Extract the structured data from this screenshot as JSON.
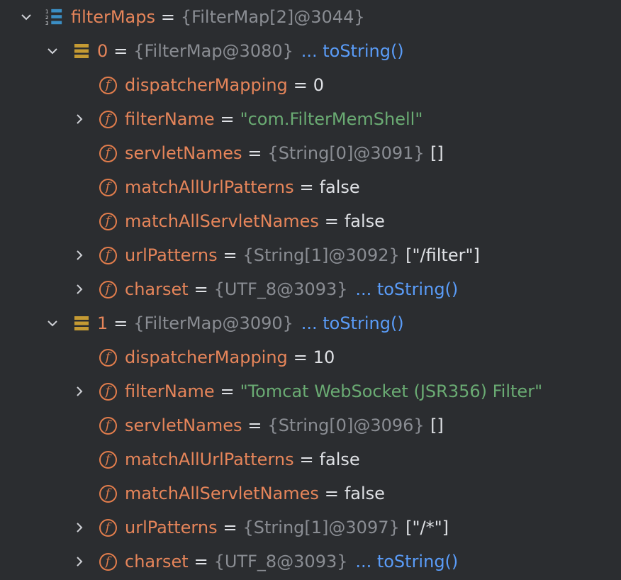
{
  "colors": {
    "background": "#2b2d30",
    "field_name": "#e6855a",
    "field_icon": "#e27d4c",
    "type_text": "#8a8d93",
    "string_value": "#6aab73",
    "link": "#5a9cf8",
    "plain_value": "#dfe1e5",
    "array_icon": "#c49a33",
    "list_icon": "#3b8ec4"
  },
  "icons": {
    "chevron_expanded": "chevron-down-icon",
    "chevron_collapsed": "chevron-right-icon",
    "field": "field-icon",
    "array_element": "array-element-icon",
    "list_root": "ordered-list-icon"
  },
  "field_glyph": "f",
  "root": {
    "name": "filterMaps",
    "eq": "=",
    "type": "{FilterMap[2]@3044}"
  },
  "items": [
    {
      "index": "0",
      "eq": "=",
      "type": "{FilterMap@3080}",
      "link": "... toString()",
      "fields": [
        {
          "name": "dispatcherMapping",
          "eq": "=",
          "value": "0"
        },
        {
          "name": "filterName",
          "eq": "=",
          "string": "\"com.FilterMemShell\""
        },
        {
          "name": "servletNames",
          "eq": "=",
          "type": "{String[0]@3091}",
          "value": "[]"
        },
        {
          "name": "matchAllUrlPatterns",
          "eq": "=",
          "value": "false"
        },
        {
          "name": "matchAllServletNames",
          "eq": "=",
          "value": "false"
        },
        {
          "name": "urlPatterns",
          "eq": "=",
          "type": "{String[1]@3092}",
          "value": "[\"/filter\"]"
        },
        {
          "name": "charset",
          "eq": "=",
          "type": "{UTF_8@3093}",
          "link": "... toString()"
        }
      ]
    },
    {
      "index": "1",
      "eq": "=",
      "type": "{FilterMap@3090}",
      "link": "... toString()",
      "fields": [
        {
          "name": "dispatcherMapping",
          "eq": "=",
          "value": "10"
        },
        {
          "name": "filterName",
          "eq": "=",
          "string": "\"Tomcat WebSocket (JSR356) Filter\""
        },
        {
          "name": "servletNames",
          "eq": "=",
          "type": "{String[0]@3096}",
          "value": "[]"
        },
        {
          "name": "matchAllUrlPatterns",
          "eq": "=",
          "value": "false"
        },
        {
          "name": "matchAllServletNames",
          "eq": "=",
          "value": "false"
        },
        {
          "name": "urlPatterns",
          "eq": "=",
          "type": "{String[1]@3097}",
          "value": "[\"/*\"]"
        },
        {
          "name": "charset",
          "eq": "=",
          "type": "{UTF_8@3093}",
          "link": "... toString()"
        }
      ]
    }
  ]
}
